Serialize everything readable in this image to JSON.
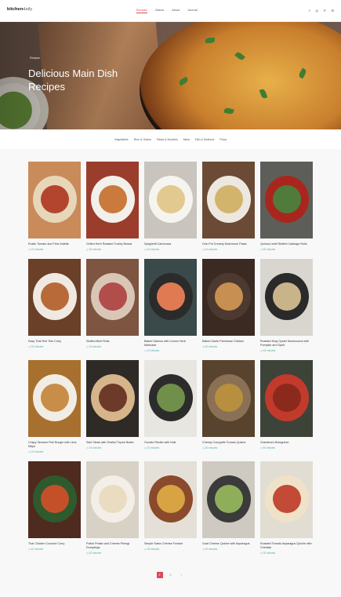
{
  "nav": {
    "brand_bold": "kitchen",
    "brand_rest": "daily",
    "menu": [
      "Recipes",
      "Videos",
      "About",
      "Journal"
    ],
    "social_icons": [
      "facebook-icon",
      "instagram-icon",
      "pinterest-icon",
      "email-icon"
    ],
    "social_glyphs": [
      "f",
      "◎",
      "P",
      "✉"
    ]
  },
  "hero": {
    "breadcrumb": "Recipes",
    "title": "Delicious Main Dish Recipes"
  },
  "categories": [
    "Vegetables",
    "Rice & Grains",
    "Pasta & Noodles",
    "Meat",
    "Fish & Seafood",
    "Pizza"
  ],
  "cards": [
    {
      "title": "Rustic Tomato and Feta Galette",
      "meta": "15 minutes",
      "bg": "#c98b5a",
      "fg": "#b3452f",
      "plate": "#e8d6b8"
    },
    {
      "title": "Grilled Herb Roasted Turkey Breast",
      "meta": "35 minutes",
      "bg": "#9b3d2c",
      "fg": "#c97a3c",
      "plate": "#f2f0ea"
    },
    {
      "title": "Spaghetti Carbonara",
      "meta": "15 minutes",
      "bg": "#c9c4bd",
      "fg": "#e1c98f",
      "plate": "#f6f4ef"
    },
    {
      "title": "One-Pot Creamy Mushroom Pasta",
      "meta": "40 minutes",
      "bg": "#6b4b35",
      "fg": "#d3b46c",
      "plate": "#ece8df"
    },
    {
      "title": "Quinoa Lentil Stuffed Cabbage Rolls",
      "meta": "60 minutes",
      "bg": "#5d5e5a",
      "fg": "#4f7c3a",
      "plate": "#a9261f"
    },
    {
      "title": "Easy Thai Red Tofu Curry",
      "meta": "30 minutes",
      "bg": "#6a4029",
      "fg": "#b86a38",
      "plate": "#efe9e2"
    },
    {
      "title": "Stuffed Beef Rolls",
      "meta": "15 minutes",
      "bg": "#7d5541",
      "fg": "#b14d4a",
      "plate": "#d9c6b6"
    },
    {
      "title": "Baked Salmon with Lemon Herb Marinade",
      "meta": "15 minutes",
      "bg": "#3a4a4a",
      "fg": "#e07a52",
      "plate": "#2b2b2b"
    },
    {
      "title": "Baked Garlic Parmesan Chicken",
      "meta": "60 minutes",
      "bg": "#3b2a22",
      "fg": "#c88f52",
      "plate": "#4c3a30"
    },
    {
      "title": "Roasted King Oyster Mushrooms with Pumpkin and Spelt",
      "meta": "45 minutes",
      "bg": "#d9d6d0",
      "fg": "#c9b48a",
      "plate": "#2a2a2a"
    },
    {
      "title": "Crispy Sesame Fish Burger with Lime Mayo",
      "meta": "20 minutes",
      "bg": "#a8702f",
      "fg": "#c88d48",
      "plate": "#f1ede5"
    },
    {
      "title": "Skirt Steak with Shallot Thyme Butter",
      "meta": "15 minutes",
      "bg": "#2e2a26",
      "fg": "#6d3a2a",
      "plate": "#d6b58a"
    },
    {
      "title": "Orzotto Risotto with Kale",
      "meta": "20 minutes",
      "bg": "#e8e6e1",
      "fg": "#6f8f4a",
      "plate": "#2c2c2c"
    },
    {
      "title": "Cheesy Courgette Tomato Quiche",
      "meta": "30 minutes",
      "bg": "#58432e",
      "fg": "#b78f3e",
      "plate": "#8a7054"
    },
    {
      "title": "Grandma's Bolognese",
      "meta": "60 minutes",
      "bg": "#3d4338",
      "fg": "#8b2a1c",
      "plate": "#c23a2b"
    },
    {
      "title": "Thai Chicken Coconut Curry",
      "meta": "40 minutes",
      "bg": "#4f2a1e",
      "fg": "#c4502a",
      "plate": "#2e5a2d"
    },
    {
      "title": "Polish Potato and Cheese Pierogi Dumplings",
      "meta": "30 minutes",
      "bg": "#d8d2c6",
      "fg": "#e9dcc0",
      "plate": "#f3efe8"
    },
    {
      "title": "Simple Swiss Cheese Fondue",
      "meta": "25 minutes",
      "bg": "#e4e0d8",
      "fg": "#d7a343",
      "plate": "#8a4a2b"
    },
    {
      "title": "Goat Cheese Quiche with Asparagus",
      "meta": "50 minutes",
      "bg": "#cfcac1",
      "fg": "#8fae5a",
      "plate": "#3b3b3b"
    },
    {
      "title": "Roasted Tomato Asparagus Quiche with Cheddar",
      "meta": "30 minutes",
      "bg": "#e2ddd3",
      "fg": "#c24a36",
      "plate": "#f0e2c8"
    }
  ],
  "pagination": [
    "1",
    "2",
    "›"
  ]
}
